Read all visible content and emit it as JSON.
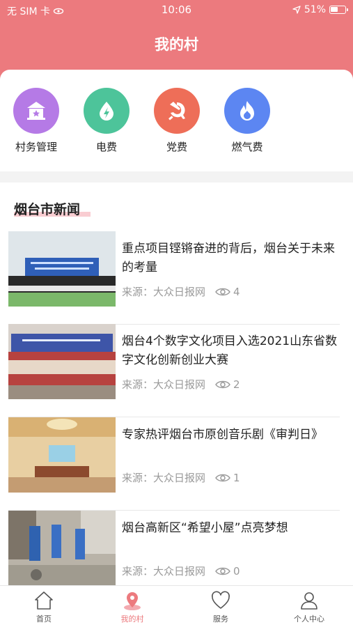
{
  "status_bar": {
    "carrier": "无 SIM 卡",
    "time": "10:06",
    "battery": "51%"
  },
  "header": {
    "title": "我的村"
  },
  "quick_actions": [
    {
      "label": "村务管理",
      "icon": "village-affairs-icon",
      "color": "#b57ae6"
    },
    {
      "label": "电费",
      "icon": "electricity-icon",
      "color": "#4dc49a"
    },
    {
      "label": "党费",
      "icon": "party-fee-icon",
      "color": "#ee6e58"
    },
    {
      "label": "燃气费",
      "icon": "gas-flame-icon",
      "color": "#5c86f2"
    }
  ],
  "news": {
    "section_title": "烟台市新闻",
    "items": [
      {
        "title": "重点项目铿锵奋进的背后，烟台关于未来的考量",
        "source": "来源：大众日报网",
        "views": "4"
      },
      {
        "title": "烟台4个数字文化项目入选2021山东省数字文化创新创业大赛",
        "source": "来源：大众日报网",
        "views": "2"
      },
      {
        "title": "专家热评烟台市原创音乐剧《审判日》",
        "source": "来源：大众日报网",
        "views": "1"
      },
      {
        "title": "烟台高新区“希望小屋”点亮梦想",
        "source": "来源：大众日报网",
        "views": "0"
      }
    ]
  },
  "tabbar": {
    "tabs": [
      {
        "label": "首页",
        "icon": "home-icon"
      },
      {
        "label": "我的村",
        "icon": "location-pin-icon",
        "active": true
      },
      {
        "label": "服务",
        "icon": "heart-icon"
      },
      {
        "label": "个人中心",
        "icon": "person-icon"
      }
    ]
  },
  "colors": {
    "brand": "#ec7a7e",
    "active_tab": "#ec7a7e"
  }
}
